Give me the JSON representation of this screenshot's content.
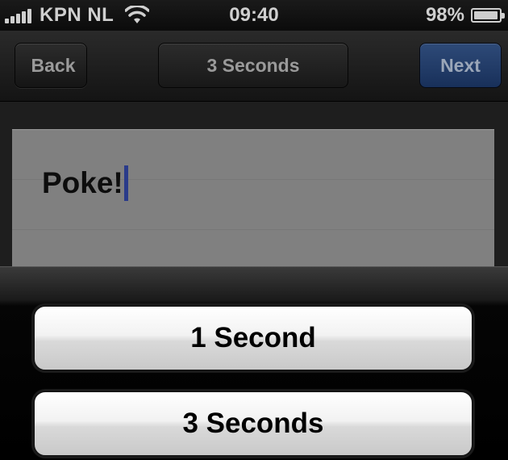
{
  "status_bar": {
    "carrier": "KPN NL",
    "time": "09:40",
    "battery_percent": "98%",
    "battery_level": 0.98,
    "signal_bars": 5,
    "wifi_icon": "wifi-icon"
  },
  "nav_bar": {
    "back_label": "Back",
    "title": "3 Seconds",
    "next_label": "Next"
  },
  "editor": {
    "text": "Poke!"
  },
  "action_sheet": {
    "options": [
      {
        "label": "1 Second"
      },
      {
        "label": "3 Seconds"
      }
    ]
  },
  "colors": {
    "next_button": "#1f3a6a",
    "caret": "#2a3b8a",
    "text_area": "#808080"
  }
}
